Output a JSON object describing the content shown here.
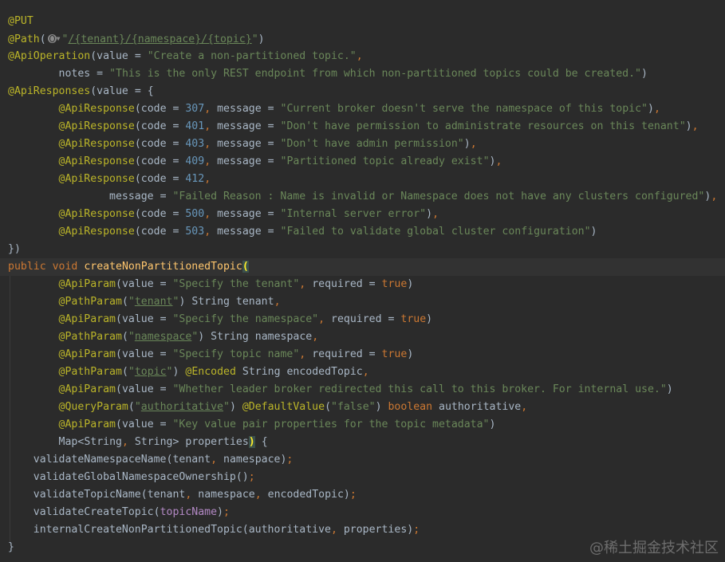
{
  "watermark": "@稀土掘金技术社区",
  "colors": {
    "background": "#2b2b2b",
    "annotation": "#bbb529",
    "string": "#6a8759",
    "number": "#6897bb",
    "keyword": "#cc7832",
    "method": "#ffc66d",
    "parameter": "#b389c5",
    "text": "#a9b7c6"
  },
  "code_lines": [
    "@PUT",
    "@Path(\"/{tenant}/{namespace}/{topic}\")",
    "@ApiOperation(value = \"Create a non-partitioned topic.\",",
    "        notes = \"This is the only REST endpoint from which non-partitioned topics could be created.\")",
    "@ApiResponses(value = {",
    "        @ApiResponse(code = 307, message = \"Current broker doesn't serve the namespace of this topic\"),",
    "        @ApiResponse(code = 401, message = \"Don't have permission to administrate resources on this tenant\"),",
    "        @ApiResponse(code = 403, message = \"Don't have admin permission\"),",
    "        @ApiResponse(code = 409, message = \"Partitioned topic already exist\"),",
    "        @ApiResponse(code = 412,",
    "                message = \"Failed Reason : Name is invalid or Namespace does not have any clusters configured\"),",
    "        @ApiResponse(code = 500, message = \"Internal server error\"),",
    "        @ApiResponse(code = 503, message = \"Failed to validate global cluster configuration\")",
    "})",
    "public void createNonPartitionedTopic(",
    "        @ApiParam(value = \"Specify the tenant\", required = true)",
    "        @PathParam(\"tenant\") String tenant,",
    "        @ApiParam(value = \"Specify the namespace\", required = true)",
    "        @PathParam(\"namespace\") String namespace,",
    "        @ApiParam(value = \"Specify topic name\", required = true)",
    "        @PathParam(\"topic\") @Encoded String encodedTopic,",
    "        @ApiParam(value = \"Whether leader broker redirected this call to this broker. For internal use.\")",
    "        @QueryParam(\"authoritative\") @DefaultValue(\"false\") boolean authoritative,",
    "        @ApiParam(value = \"Key value pair properties for the topic metadata\")",
    "        Map<String, String> properties) {",
    "    validateNamespaceName(tenant, namespace);",
    "    validateGlobalNamespaceOwnership();",
    "    validateTopicName(tenant, namespace, encodedTopic);",
    "    validateCreateTopic(topicName);",
    "    internalCreateNonPartitionedTopic(authoritative, properties);",
    "}"
  ]
}
